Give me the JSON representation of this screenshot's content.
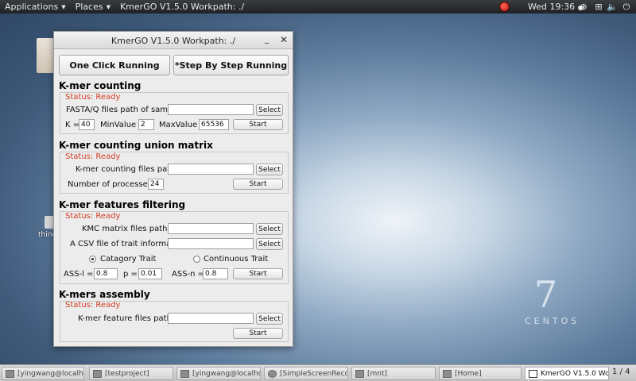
{
  "topbar": {
    "applications": "Applications",
    "places": "Places",
    "active_app": "KmerGO V1.5.0 Workpath: ./",
    "clock": "Wed 19:36",
    "clock_dot": "●"
  },
  "desktop": {
    "icon_label": "thinc",
    "logo_number": "7",
    "logo_text": "CENTOS"
  },
  "window": {
    "title": "KmerGO V1.5.0 Workpath: ./",
    "minimize": "_",
    "close": "✕",
    "one_click": "One Click Running",
    "step_by_step": "*Step By Step Running"
  },
  "kmer_counting": {
    "title": "K-mer counting",
    "status": "Status: Ready",
    "path_label": "FASTA/Q files path of samples",
    "path_value": "",
    "select": "Select",
    "k_label": "K =",
    "k_value": "40",
    "min_label": "MinValue =",
    "min_value": "2",
    "max_label": "MaxValue =",
    "max_value": "65536",
    "start": "Start"
  },
  "union_matrix": {
    "title": "K-mer counting union matrix",
    "status": "Status: Ready",
    "path_label": "K-mer counting files path",
    "path_value": "",
    "select": "Select",
    "proc_label": "Number of processes =",
    "proc_value": "24",
    "start": "Start"
  },
  "filtering": {
    "title": "K-mer features filtering",
    "status": "Status: Ready",
    "kmc_label": "KMC matrix files path",
    "kmc_value": "",
    "select1": "Select",
    "csv_label": "A CSV file of trait information",
    "csv_value": "",
    "select2": "Select",
    "radio_category": "Catagory Trait",
    "radio_continuous": "Continuous Trait",
    "assl_label": "ASS-l =",
    "assl_value": "0.8",
    "p_label": "p =",
    "p_value": "0.01",
    "assn_label": "ASS-n =",
    "assn_value": "0.8",
    "start": "Start"
  },
  "assembly": {
    "title": "K-mers assembly",
    "status": "Status: Ready",
    "path_label": "K-mer feature files path",
    "path_value": "",
    "select": "Select",
    "start": "Start"
  },
  "taskbar": {
    "tasks": [
      "[yingwang@localhos…",
      "[testproject]",
      "[yingwang@localhost…",
      "[SimpleScreenRecor…",
      "[mnt]",
      "[Home]",
      "KmerGO V1.5.0 Wo…"
    ],
    "pager": "1 / 4"
  }
}
